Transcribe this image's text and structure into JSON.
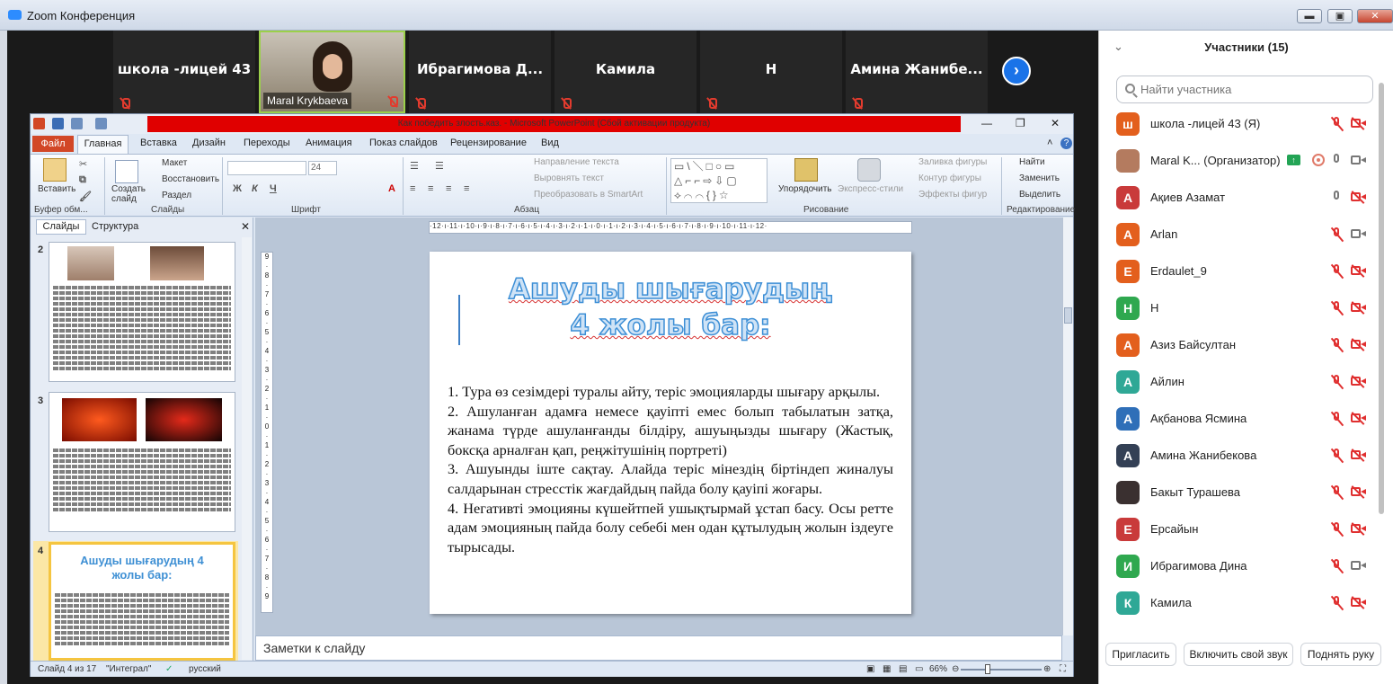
{
  "window": {
    "app_title": "Zoom Конференция",
    "min": "▬",
    "max": "▣",
    "close": "✕"
  },
  "video_strip": {
    "tiles": [
      {
        "name": "школа -лицей 43"
      },
      {
        "name": "Maral Krykbaeva"
      },
      {
        "name": "Ибрагимова  Д..."
      },
      {
        "name": "Камила"
      },
      {
        "name": "Н"
      },
      {
        "name": "Амина  Жанибе..."
      }
    ],
    "next_icon": "›"
  },
  "powerpoint": {
    "title": "Как победить злость.каз. - Microsoft PowerPoint (Сбой активации продукта)",
    "tabs": [
      "Файл",
      "Главная",
      "Вставка",
      "Дизайн",
      "Переходы",
      "Анимация",
      "Показ слайдов",
      "Рецензирование",
      "Вид"
    ],
    "ribbon": {
      "insert": "Вставить",
      "clipboard": "Буфер обм...",
      "new_slide": "Создать слайд",
      "layout": "Макет",
      "reset": "Восстановить",
      "section": "Раздел",
      "slides_group": "Слайды",
      "font_size": "24",
      "font_group": "Шрифт",
      "text_direction": "Направление текста",
      "align_text": "Выровнять текст",
      "smartart": "Преобразовать в SmartArt",
      "paragraph_group": "Абзац",
      "arrange": "Упорядочить",
      "quick_styles": "Экспресс-стили",
      "shape_fill": "Заливка фигуры",
      "shape_outline": "Контур фигуры",
      "shape_effects": "Эффекты фигур",
      "drawing_group": "Рисование",
      "find": "Найти",
      "replace": "Заменить",
      "select": "Выделить",
      "editing_group": "Редактирование"
    },
    "panel": {
      "tab_slides": "Слайды",
      "tab_outline": "Структура",
      "close": "✕"
    },
    "thumbs": [
      {
        "num": "2"
      },
      {
        "num": "3"
      },
      {
        "num": "4",
        "title": "Ашуды шығарудың 4 жолы бар:"
      }
    ],
    "ruler": "·12·ı·11·ı·10·ı·9·ı·8·ı·7·ı·6·ı·5·ı·4·ı·3·ı·2·ı·1·ı·0·ı·1·ı·2·ı·3·ı·4·ı·5·ı·6·ı·7·ı·8·ı·9·ı·10·ı·11·ı·12·",
    "slide": {
      "title_line1": "Ашуды шығарудың",
      "title_line2": "4 жолы бар:",
      "p1": "1. Тура өз сезімдері туралы айту, теріс эмоцияларды шығару арқылы.",
      "p2": "2. Ашуланған адамға немесе қауіпті емес болып табылатын затқа, жанама түрде  ашуланғанды білдіру, ашуыңызды шығару (Жастық, боксқа арналған қап, реңжітушінің портреті)",
      "p3": "3. Ашуынды іште сақтау. Алайда  теріс мінездің біртіндеп жиналуы салдарынан стресстік жағдайдың пайда болу қауіпі жоғары.",
      "p4": "4. Негативті эмоцияны күшейтпей  ушықтырмай  ұстап басу. Осы ретте адам эмоцияның пайда болу себебі мен одан құтылудың  жолын іздеуге тырысады."
    },
    "notes_placeholder": "Заметки к слайду",
    "status": {
      "slide": "Слайд 4 из 17",
      "theme": "\"Интеграл\"",
      "language": "русский",
      "zoom": "66%"
    }
  },
  "participants": {
    "title": "Участники (15)",
    "search_placeholder": "Найти участника",
    "list": [
      {
        "initial": "ш",
        "color": "#e35f1d",
        "name": "школа -лицей 43 (Я)",
        "mic": "off",
        "cam": "off"
      },
      {
        "initial": "",
        "color": "#b47b5f",
        "name": "Maral K...  (Организатор)",
        "mic": "on",
        "cam": "on"
      },
      {
        "initial": "А",
        "color": "#c93a3a",
        "name": "Ақиев Азамат",
        "mic": "on",
        "cam": "off"
      },
      {
        "initial": "A",
        "color": "#e35f1d",
        "name": "Arlan",
        "mic": "off",
        "cam": "on"
      },
      {
        "initial": "E",
        "color": "#e35f1d",
        "name": "Erdaulet_9",
        "mic": "off",
        "cam": "off"
      },
      {
        "initial": "Н",
        "color": "#2fa84f",
        "name": "Н",
        "mic": "off",
        "cam": "off"
      },
      {
        "initial": "А",
        "color": "#e35f1d",
        "name": "Азиз Байсултан",
        "mic": "off",
        "cam": "off"
      },
      {
        "initial": "А",
        "color": "#2fa896",
        "name": "Айлин",
        "mic": "off",
        "cam": "off"
      },
      {
        "initial": "А",
        "color": "#2f6fb8",
        "name": "Ақбанова Ясмина",
        "mic": "off",
        "cam": "off"
      },
      {
        "initial": "А",
        "color": "#334055",
        "name": "Амина Жанибекова",
        "mic": "off",
        "cam": "off"
      },
      {
        "initial": "",
        "color": "#3a3030",
        "name": "Бакыт Турашева",
        "mic": "off",
        "cam": "off"
      },
      {
        "initial": "Е",
        "color": "#c93a3a",
        "name": "Ерсайын",
        "mic": "off",
        "cam": "off"
      },
      {
        "initial": "И",
        "color": "#2fa84f",
        "name": "Ибрагимова Дина",
        "mic": "off",
        "cam": "on"
      },
      {
        "initial": "К",
        "color": "#2fa896",
        "name": "Камила",
        "mic": "off",
        "cam": "off"
      }
    ],
    "footer": {
      "invite": "Пригласить",
      "unmute": "Включить свой звук",
      "raise_hand": "Поднять руку"
    }
  }
}
